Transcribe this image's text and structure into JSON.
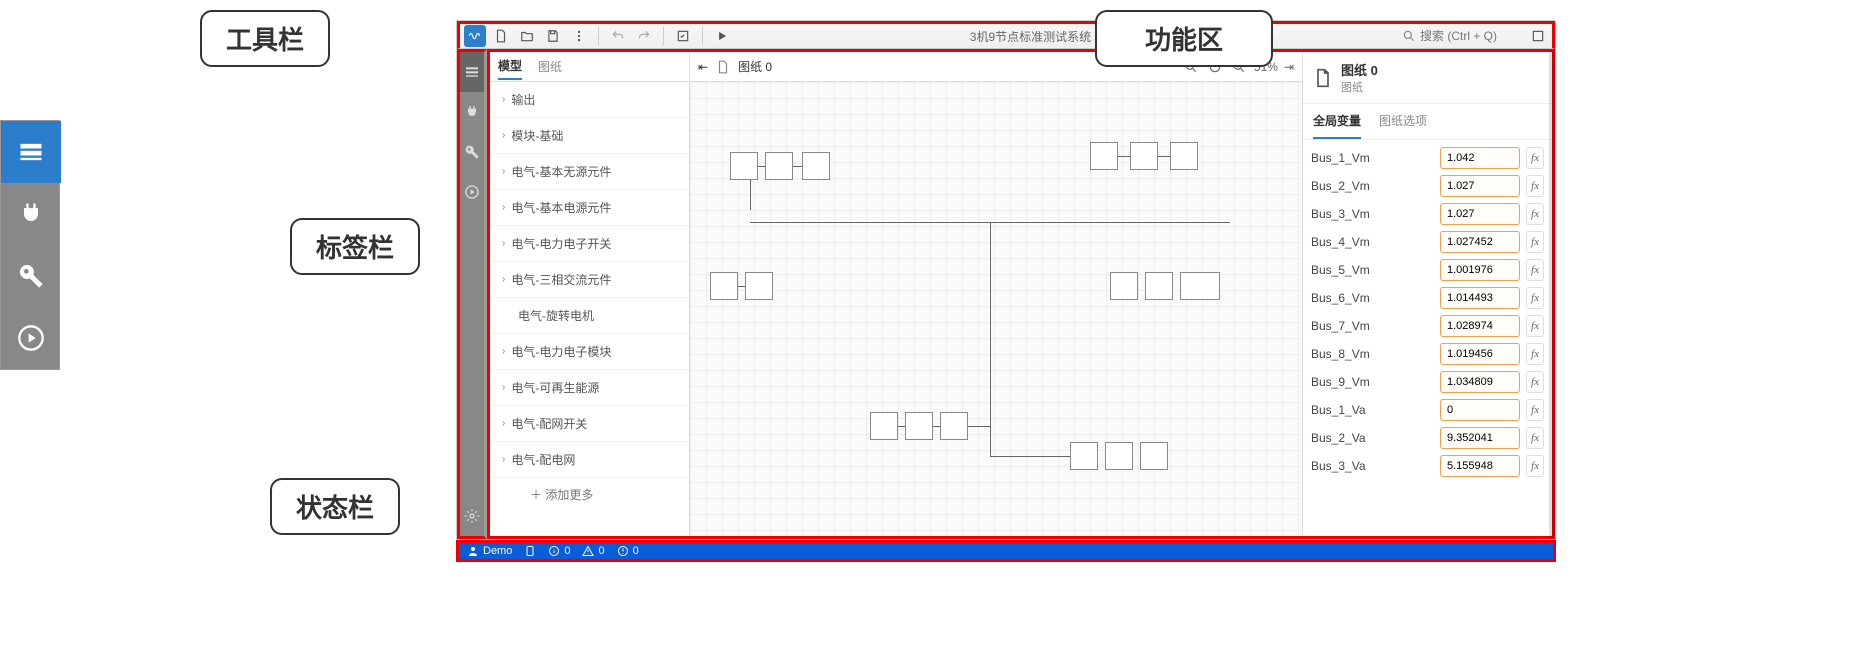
{
  "callouts": {
    "toolbar": "工具栏",
    "tabbar": "标签栏",
    "statusbar": "状态栏",
    "ribbon": "功能区"
  },
  "toolbar": {
    "title": "3机9节点标准测试系统 - CloudPSS",
    "search_placeholder": "搜索 (Ctrl + Q)"
  },
  "tree": {
    "tabs": {
      "model": "模型",
      "sheet": "图纸"
    },
    "items": [
      "输出",
      "模块-基础",
      "电气-基本无源元件",
      "电气-基本电源元件",
      "电气-电力电子开关",
      "电气-三相交流元件",
      "电气-旋转电机",
      "电气-电力电子模块",
      "电气-可再生能源",
      "电气-配网开关",
      "电气-配电网"
    ],
    "add_more": "添加更多"
  },
  "canvas": {
    "tab_label": "图纸 0",
    "zoom": "51%"
  },
  "props": {
    "title": "图纸 0",
    "subtitle": "图纸",
    "tabs": {
      "globals": "全局变量",
      "options": "图纸选项"
    },
    "vars": [
      {
        "name": "Bus_1_Vm",
        "value": "1.042"
      },
      {
        "name": "Bus_2_Vm",
        "value": "1.027"
      },
      {
        "name": "Bus_3_Vm",
        "value": "1.027"
      },
      {
        "name": "Bus_4_Vm",
        "value": "1.027452"
      },
      {
        "name": "Bus_5_Vm",
        "value": "1.001976"
      },
      {
        "name": "Bus_6_Vm",
        "value": "1.014493"
      },
      {
        "name": "Bus_7_Vm",
        "value": "1.028974"
      },
      {
        "name": "Bus_8_Vm",
        "value": "1.019456"
      },
      {
        "name": "Bus_9_Vm",
        "value": "1.034809"
      },
      {
        "name": "Bus_1_Va",
        "value": "0"
      },
      {
        "name": "Bus_2_Va",
        "value": "9.352041"
      },
      {
        "name": "Bus_3_Va",
        "value": "5.155948"
      }
    ],
    "fx_label": "fx"
  },
  "statusbar": {
    "user": "Demo",
    "info_count": "0",
    "warn_count": "0",
    "error_count": "0"
  }
}
